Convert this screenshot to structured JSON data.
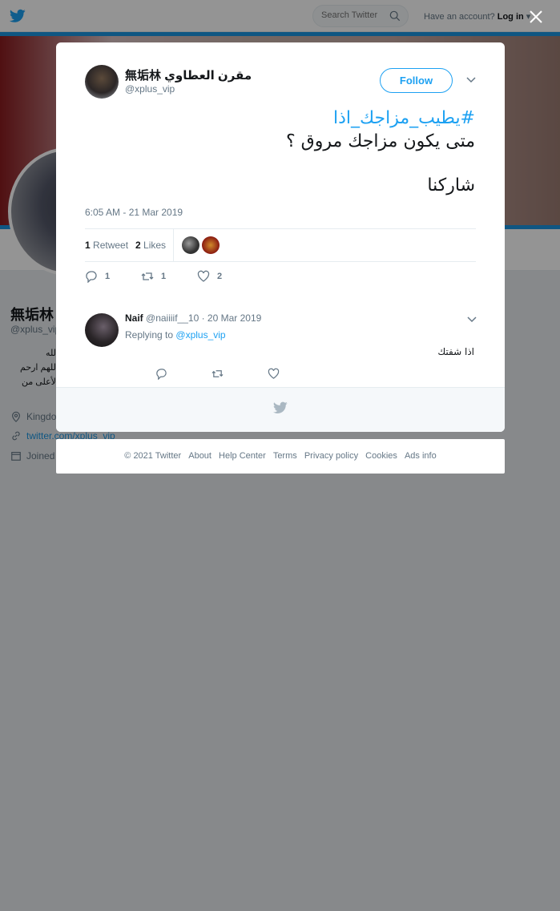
{
  "topbar": {
    "search_placeholder": "Search Twitter",
    "account_prompt": "Have an account?",
    "login_label": "Log in"
  },
  "profile": {
    "name": "無垢林",
    "handle": "@xplus_vip",
    "bio": "الله\nاللهم ارحم\nالأعلى من",
    "location": "Kingdo",
    "website": "twitter.com/xplus_vip",
    "joined": "Joined"
  },
  "tweet": {
    "author_name": "無垢林 مقرن العطاوي",
    "author_handle": "@xplus_vip",
    "follow_label": "Follow",
    "hashtag": "#يطيب_مزاجك_اذا",
    "line2": "متى يكون مزاجك مروق ؟",
    "line3": "شاركنا",
    "timestamp": "6:05 AM - 21 Mar 2019",
    "retweet_count": "1",
    "retweet_label": "Retweet",
    "likes_count": "2",
    "likes_label": "Likes",
    "action_reply_count": "1",
    "action_retweet_count": "1",
    "action_like_count": "2"
  },
  "reply": {
    "name": "Naif",
    "handle": "@naiiiif__10",
    "date": "· 20 Mar 2019",
    "replying_prefix": "Replying to",
    "replying_handle": "@xplus_vip",
    "text": "اذا شفتك"
  },
  "footer": {
    "copyright": "© 2021 Twitter",
    "about": "About",
    "help": "Help Center",
    "terms": "Terms",
    "privacy": "Privacy policy",
    "cookies": "Cookies",
    "ads": "Ads info"
  },
  "colors": {
    "accent": "#1da1f2",
    "text": "#14171a",
    "muted": "#657786"
  }
}
